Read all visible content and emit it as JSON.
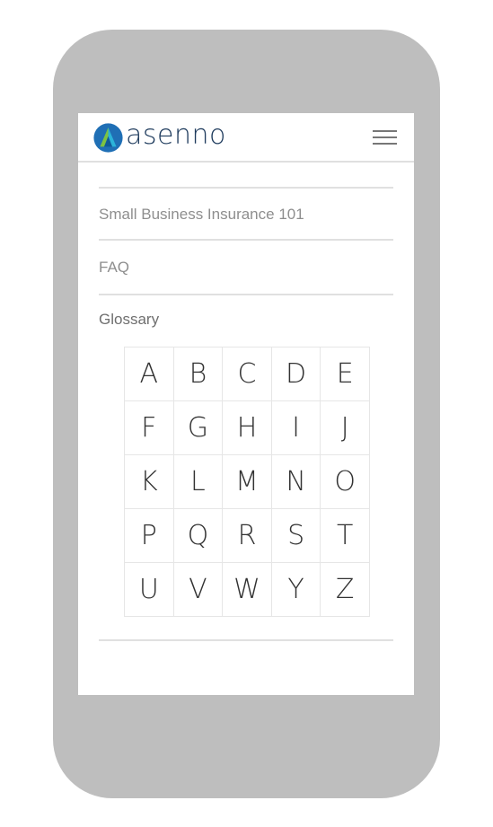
{
  "brand": {
    "name": "asenno",
    "colors": {
      "text": "#1d3a5c",
      "mark_blue": "#1f6fb5",
      "mark_green": "#7cc242",
      "mark_cyan": "#2bb3d9"
    }
  },
  "header": {
    "menu_icon": "hamburger-icon"
  },
  "nav": {
    "items": [
      {
        "label": "Small Business Insurance 101"
      },
      {
        "label": "FAQ"
      }
    ]
  },
  "glossary": {
    "title": "Glossary",
    "letters": [
      "A",
      "B",
      "C",
      "D",
      "E",
      "F",
      "G",
      "H",
      "I",
      "J",
      "K",
      "L",
      "M",
      "N",
      "O",
      "P",
      "Q",
      "R",
      "S",
      "T",
      "U",
      "V",
      "W",
      "Y",
      "Z"
    ]
  }
}
